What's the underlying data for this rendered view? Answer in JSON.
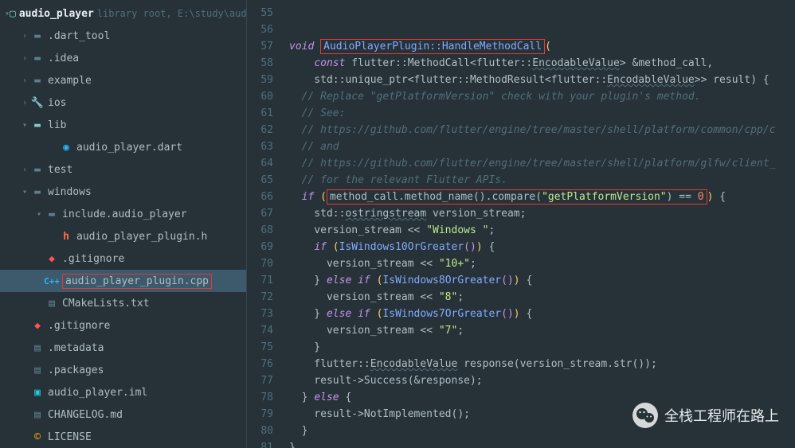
{
  "project": {
    "root_name": "audio_player",
    "root_hint": "library root, E:\\study\\audio_play",
    "items": [
      {
        "label": ".dart_tool",
        "icon": "folder",
        "indent": 1,
        "chev": "right"
      },
      {
        "label": ".idea",
        "icon": "folder",
        "indent": 1,
        "chev": "right"
      },
      {
        "label": "example",
        "icon": "folder",
        "indent": 1,
        "chev": "right"
      },
      {
        "label": "ios",
        "icon": "wrench",
        "indent": 1,
        "chev": "right"
      },
      {
        "label": "lib",
        "icon": "lib",
        "indent": 1,
        "chev": "down"
      },
      {
        "label": "audio_player.dart",
        "icon": "dart",
        "indent": 3,
        "chev": ""
      },
      {
        "label": "test",
        "icon": "folder",
        "indent": 1,
        "chev": "right"
      },
      {
        "label": "windows",
        "icon": "folder",
        "indent": 1,
        "chev": "down"
      },
      {
        "label": "include.audio_player",
        "icon": "folder",
        "indent": 2,
        "chev": "down"
      },
      {
        "label": "audio_player_plugin.h",
        "icon": "h",
        "indent": 3,
        "chev": ""
      },
      {
        "label": ".gitignore",
        "icon": "git",
        "indent": 2,
        "chev": ""
      },
      {
        "label": "audio_player_plugin.cpp",
        "icon": "cpp",
        "indent": 2,
        "chev": "",
        "selected": true,
        "boxed": true
      },
      {
        "label": "CMakeLists.txt",
        "icon": "file",
        "indent": 2,
        "chev": ""
      },
      {
        "label": ".gitignore",
        "icon": "git",
        "indent": 1,
        "chev": ""
      },
      {
        "label": ".metadata",
        "icon": "file",
        "indent": 1,
        "chev": ""
      },
      {
        "label": ".packages",
        "icon": "file",
        "indent": 1,
        "chev": ""
      },
      {
        "label": "audio_player.iml",
        "icon": "iml",
        "indent": 1,
        "chev": ""
      },
      {
        "label": "CHANGELOG.md",
        "icon": "file",
        "indent": 1,
        "chev": ""
      },
      {
        "label": "LICENSE",
        "icon": "lic",
        "indent": 1,
        "chev": ""
      }
    ]
  },
  "gutter": {
    "start": 55,
    "end": 81
  },
  "code": {
    "l55": "",
    "l56_void": "void",
    "l56_sig": "AudioPlayerPlugin::HandleMethodCall",
    "l57_const": "const",
    "l57_rest": " flutter::MethodCall<flutter::",
    "l57_enc": "EncodableValue",
    "l57_tail": "> &method_call,",
    "l58": "    std::unique_ptr<flutter::MethodResult<flutter::",
    "l58_enc": "EncodableValue",
    "l58_tail": ">> result) {",
    "l59": "  // Replace \"getPlatformVersion\" check with your plugin's method.",
    "l60": "  // See:",
    "l61": "  // https://github.com/flutter/engine/tree/master/shell/platform/common/cpp/c",
    "l62": "  // and",
    "l63": "  // https://github.com/flutter/engine/tree/master/shell/platform/glfw/client_",
    "l64": "  // for the relevant Flutter APIs.",
    "l65_if": "if",
    "l65_cond": "method_call.method_name().compare(",
    "l65_str": "\"getPlatformVersion\"",
    "l65_eq": ") == ",
    "l65_zero": "0",
    "l66_a": "    std::",
    "l66_b": "ostringstream",
    "l66_c": " version_stream;",
    "l67_a": "    version_stream << ",
    "l67_str": "\"Windows \"",
    "l68_if": "if",
    "l68_fn": "IsWindows10OrGreater",
    "l69_a": "      version_stream << ",
    "l69_str": "\"10+\"",
    "l70_else": "else",
    "l70_if": "if",
    "l70_fn": "IsWindows8OrGreater",
    "l71_a": "      version_stream << ",
    "l71_str": "\"8\"",
    "l72_else": "else",
    "l72_if": "if",
    "l72_fn": "IsWindows7OrGreater",
    "l73_a": "      version_stream << ",
    "l73_str": "\"7\"",
    "l75_a": "    flutter::",
    "l75_b": "EncodableValue",
    "l75_c": " response(version_stream.str());",
    "l76": "    result->Success(&response);",
    "l77_else": "else",
    "l78": "    result->NotImplemented();"
  },
  "watermark": "全栈工程师在路上"
}
